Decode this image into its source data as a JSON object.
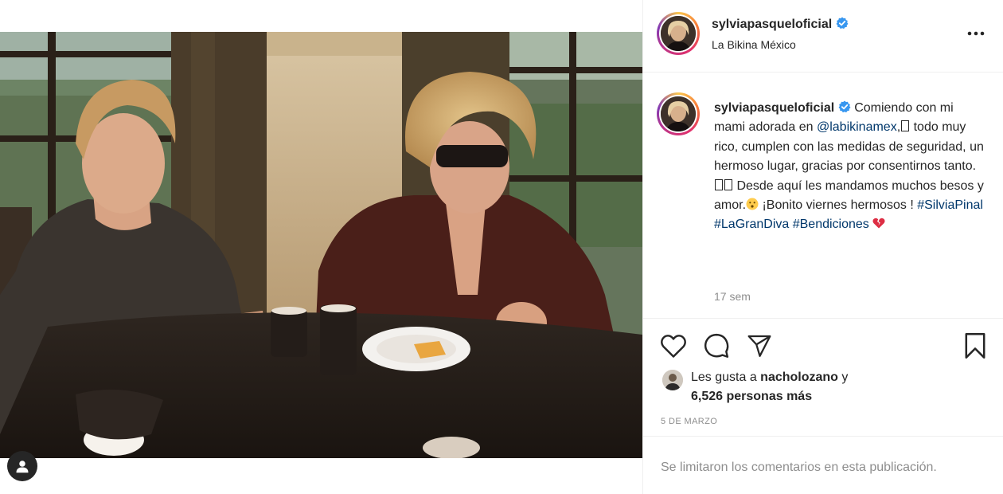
{
  "post": {
    "username": "sylviapasqueloficial",
    "location": "La Bikina México",
    "caption": {
      "intro": "Comiendo con mi mami adorada en ",
      "mention": "@labikinamex",
      "part2": ",",
      "part3": " todo muy rico, cumplen con las medidas de seguridad, un hermoso lugar, gracias por consentirnos tanto. ",
      "part4": " Desde aquí les mandamos muchos besos y amor.",
      "part5": " ¡Bonito viernes hermosos ! ",
      "hashtags": [
        "#SilviaPinal",
        "#LaGranDiva",
        "#Bendiciones"
      ]
    },
    "time_ago": "17 sem",
    "likes": {
      "prefix": "Les gusta a ",
      "liker": "nacholozano",
      "connector": " y",
      "others": "6,526 personas más"
    },
    "date": "5 DE MARZO",
    "comments_disabled": "Se limitaron los comentarios en esta publicación."
  },
  "icons": {
    "verified": "verified-badge-icon",
    "more": "more-options-icon",
    "like": "heart-icon",
    "comment": "comment-bubble-icon",
    "share": "paper-plane-icon",
    "save": "bookmark-icon",
    "tagged_user": "user-silhouette-icon"
  },
  "colors": {
    "verified": "#3897f0",
    "link": "#00376b",
    "muted": "#8e8e8e",
    "text": "#262626",
    "border": "#efefef"
  }
}
